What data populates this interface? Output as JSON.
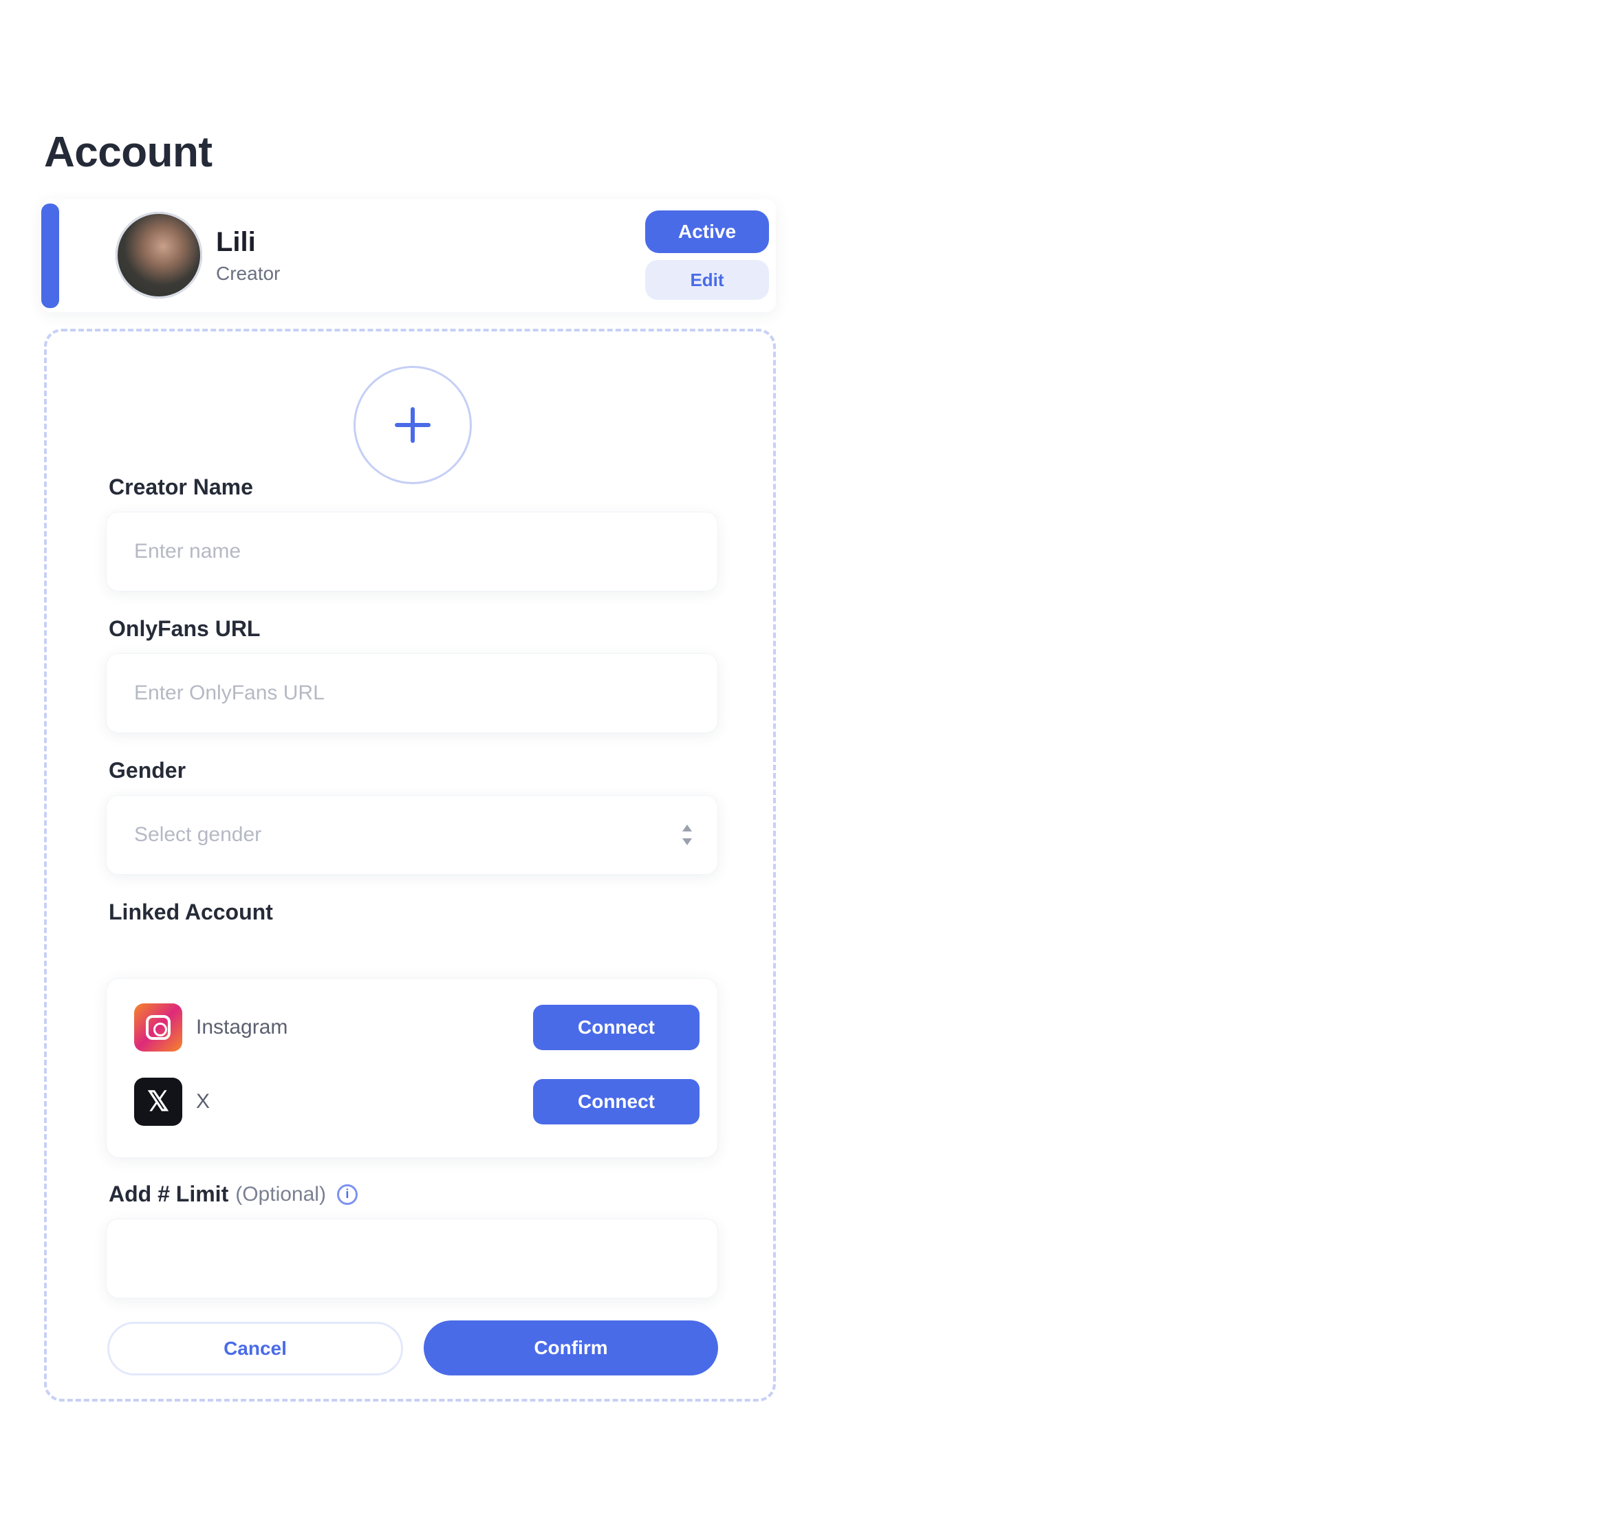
{
  "page": {
    "title": "Account"
  },
  "profile": {
    "name": "Lili",
    "role": "Creator",
    "active_label": "Active",
    "edit_label": "Edit"
  },
  "form": {
    "creator_name": {
      "label": "Creator Name",
      "placeholder": "Enter name",
      "value": ""
    },
    "onlyfans_url": {
      "label": "OnlyFans URL",
      "placeholder": "Enter OnlyFans URL",
      "value": ""
    },
    "gender": {
      "label": "Gender",
      "placeholder": "Select gender"
    },
    "linked_account": {
      "label": "Linked Account",
      "items": [
        {
          "name": "Instagram",
          "icon": "instagram-icon",
          "action": "Connect"
        },
        {
          "name": "X",
          "icon": "x-icon",
          "action": "Connect"
        }
      ]
    },
    "tag": {
      "label": "Add # Limit",
      "optional": "(Optional)",
      "value": ""
    },
    "cancel_label": "Cancel",
    "confirm_label": "Confirm"
  },
  "colors": {
    "accent": "#4a6be8",
    "accent_soft": "#e9edfb",
    "dashed_border": "#c7d0f5"
  }
}
